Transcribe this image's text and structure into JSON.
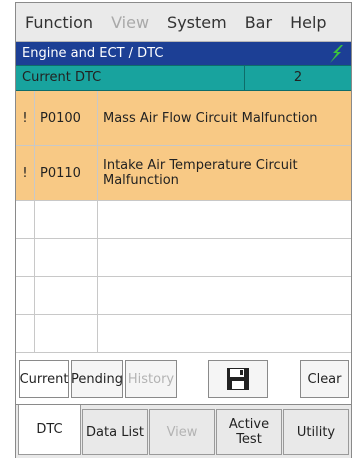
{
  "menu": {
    "items": [
      {
        "label": "Function",
        "enabled": true
      },
      {
        "label": "View",
        "enabled": false
      },
      {
        "label": "System",
        "enabled": true
      },
      {
        "label": "Bar",
        "enabled": true
      },
      {
        "label": "Help",
        "enabled": true
      }
    ]
  },
  "title": "Engine and ECT / DTC",
  "dtc_header": {
    "label": "Current DTC",
    "count": "2"
  },
  "dtc_rows": [
    {
      "flag": "!",
      "code": "P0100",
      "description": "Mass Air Flow Circuit Malfunction"
    },
    {
      "flag": "!",
      "code": "P0110",
      "description": "Intake Air Temperature Circuit Malfunction"
    }
  ],
  "buttons": {
    "current": "Current",
    "pending": "Pending",
    "history": "History",
    "save_icon": "floppy-disk-icon",
    "clear": "Clear"
  },
  "tabs": {
    "dtc": "DTC",
    "data_list": "Data List",
    "view": "View",
    "active_test": "Active Test",
    "utility": "Utility"
  },
  "colors": {
    "title_bar": "#1c3f95",
    "dtc_header": "#18a39e",
    "fault_row": "#f8c985",
    "status_icon": "#3cc43c"
  }
}
